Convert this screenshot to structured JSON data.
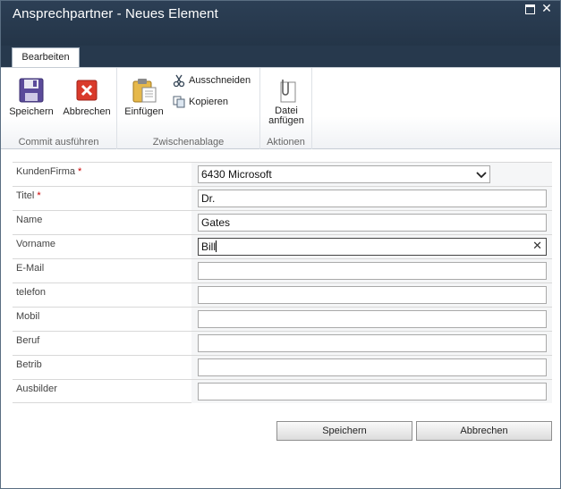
{
  "window": {
    "title": "Ansprechpartner - Neues Element"
  },
  "tabs": [
    {
      "label": "Bearbeiten"
    }
  ],
  "ribbon": {
    "commit_group": {
      "label": "Commit ausführen",
      "save_label": "Speichern",
      "cancel_label": "Abbrechen"
    },
    "clipboard_group": {
      "label": "Zwischenablage",
      "paste_label": "Einfügen",
      "cut_label": "Ausschneiden",
      "copy_label": "Kopieren"
    },
    "actions_group": {
      "label": "Aktionen",
      "attach_label_line1": "Datei",
      "attach_label_line2": "anfügen"
    }
  },
  "form": {
    "fields": [
      {
        "label": "KundenFirma",
        "required": "*",
        "value": "6430 Microsoft"
      },
      {
        "label": "Titel",
        "required": "*",
        "value": "Dr."
      },
      {
        "label": "Name",
        "value": "Gates"
      },
      {
        "label": "Vorname",
        "value": "Bill"
      },
      {
        "label": "E-Mail",
        "value": ""
      },
      {
        "label": "telefon",
        "value": ""
      },
      {
        "label": "Mobil",
        "value": ""
      },
      {
        "label": "Beruf",
        "value": ""
      },
      {
        "label": "Betrib",
        "value": ""
      },
      {
        "label": "Ausbilder",
        "value": ""
      }
    ]
  },
  "footer": {
    "save_label": "Speichern",
    "cancel_label": "Abbrechen"
  }
}
